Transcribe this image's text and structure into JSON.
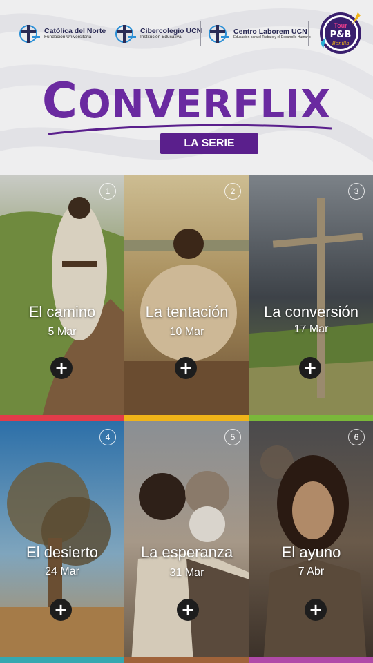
{
  "header": {
    "logos": [
      {
        "name": "Católica del Norte",
        "sub": "Fundación Universitaria"
      },
      {
        "name": "Cibercolegio UCN",
        "sub": "Institución Educativa"
      },
      {
        "name": "Centro Laborem UCN",
        "sub": "Educación para el Trabajo y el Desarrollo Humano"
      }
    ],
    "badge": {
      "line1": "Tour",
      "line2": "P&B",
      "line3": "Bonilla"
    }
  },
  "title": {
    "first": "C",
    "rest": "ONVERFLIX",
    "subtitle": "LA SERIE"
  },
  "colors": {
    "purple": "#6a2aa0",
    "stripe_row1": [
      "#e23c4a",
      "#f0b419",
      "#7ab83a"
    ],
    "stripe_row2": [
      "#35a8b0",
      "#a0633a",
      "#b04aa8"
    ]
  },
  "episodes": [
    {
      "number": "1",
      "title": "El camino",
      "date": "5 Mar"
    },
    {
      "number": "2",
      "title": "La tentación",
      "date": "10 Mar"
    },
    {
      "number": "3",
      "title": "La conversión",
      "date": "17 Mar"
    },
    {
      "number": "4",
      "title": "El desierto",
      "date": "24 Mar"
    },
    {
      "number": "5",
      "title": "La esperanza",
      "date": "31 Mar"
    },
    {
      "number": "6",
      "title": "El ayuno",
      "date": "7 Abr"
    }
  ]
}
